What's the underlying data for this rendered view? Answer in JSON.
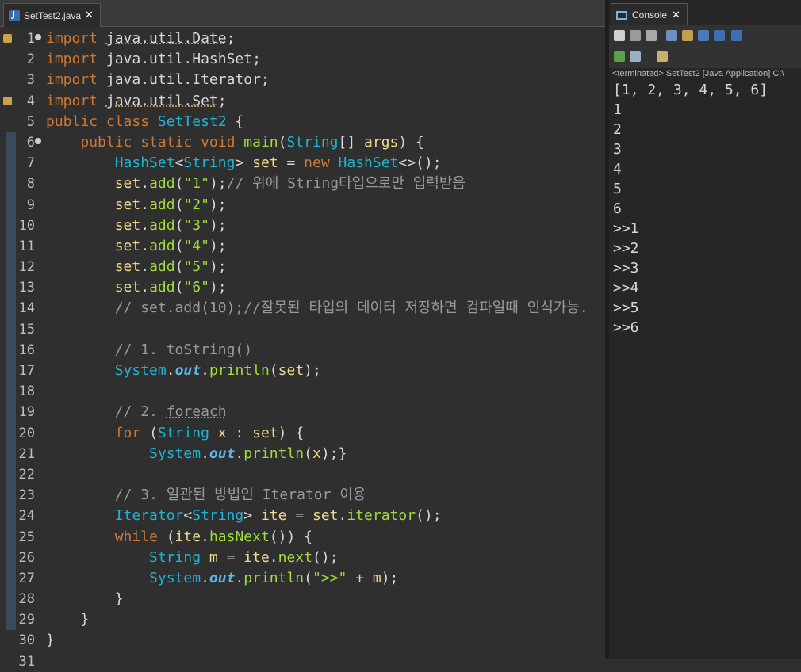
{
  "editor": {
    "tab_label": "SetTest2.java",
    "tab_close": "✕",
    "last_line_number": "31",
    "lines": [
      {
        "n": "1",
        "fold": true,
        "mark": true,
        "segs": [
          [
            "kw",
            "import "
          ],
          [
            "ul",
            "java.util.Date"
          ],
          [
            "",
            ""
          ],
          [
            "",
            ";"
          ]
        ]
      },
      {
        "n": "2",
        "segs": [
          [
            "kw",
            "import "
          ],
          [
            "",
            "java.util.HashSet;"
          ]
        ]
      },
      {
        "n": "3",
        "segs": [
          [
            "kw",
            "import "
          ],
          [
            "",
            "java.util.Iterator;"
          ]
        ]
      },
      {
        "n": "4",
        "mark": true,
        "segs": [
          [
            "kw",
            "import "
          ],
          [
            "ul",
            "java.util.Set"
          ],
          [
            "",
            ";"
          ]
        ]
      },
      {
        "n": "5",
        "segs": [
          [
            "kw",
            "public class "
          ],
          [
            "ty",
            "SetTest2"
          ],
          [
            "",
            " {"
          ]
        ]
      },
      {
        "n": "6",
        "fold": true,
        "ruler": true,
        "segs": [
          [
            "",
            "    "
          ],
          [
            "kw",
            "public static void "
          ],
          [
            "fn",
            "main"
          ],
          [
            "",
            "("
          ],
          [
            "ty",
            "String"
          ],
          [
            "",
            "[] "
          ],
          [
            "var",
            "args"
          ],
          [
            "",
            ") {"
          ]
        ]
      },
      {
        "n": "7",
        "ruler": true,
        "segs": [
          [
            "",
            "        "
          ],
          [
            "ty",
            "HashSet"
          ],
          [
            "",
            "<"
          ],
          [
            "ty",
            "String"
          ],
          [
            "",
            "> "
          ],
          [
            "var",
            "set"
          ],
          [
            "",
            " = "
          ],
          [
            "kw",
            "new "
          ],
          [
            "ty",
            "HashSet"
          ],
          [
            "",
            "<>();"
          ]
        ]
      },
      {
        "n": "8",
        "ruler": true,
        "segs": [
          [
            "",
            "        "
          ],
          [
            "var",
            "set"
          ],
          [
            "",
            "."
          ],
          [
            "fn",
            "add"
          ],
          [
            "",
            "("
          ],
          [
            "str",
            "\"1\""
          ],
          [
            "",
            ");"
          ],
          [
            "cm",
            "// 위에 String타입으로만 입력받음"
          ]
        ]
      },
      {
        "n": "9",
        "ruler": true,
        "segs": [
          [
            "",
            "        "
          ],
          [
            "var",
            "set"
          ],
          [
            "",
            "."
          ],
          [
            "fn",
            "add"
          ],
          [
            "",
            "("
          ],
          [
            "str",
            "\"2\""
          ],
          [
            "",
            ");"
          ]
        ]
      },
      {
        "n": "10",
        "ruler": true,
        "segs": [
          [
            "",
            "        "
          ],
          [
            "var",
            "set"
          ],
          [
            "",
            "."
          ],
          [
            "fn",
            "add"
          ],
          [
            "",
            "("
          ],
          [
            "str",
            "\"3\""
          ],
          [
            "",
            ");"
          ]
        ]
      },
      {
        "n": "11",
        "ruler": true,
        "segs": [
          [
            "",
            "        "
          ],
          [
            "var",
            "set"
          ],
          [
            "",
            "."
          ],
          [
            "fn",
            "add"
          ],
          [
            "",
            "("
          ],
          [
            "str",
            "\"4\""
          ],
          [
            "",
            ");"
          ]
        ]
      },
      {
        "n": "12",
        "ruler": true,
        "segs": [
          [
            "",
            "        "
          ],
          [
            "var",
            "set"
          ],
          [
            "",
            "."
          ],
          [
            "fn",
            "add"
          ],
          [
            "",
            "("
          ],
          [
            "str",
            "\"5\""
          ],
          [
            "",
            ");"
          ]
        ]
      },
      {
        "n": "13",
        "ruler": true,
        "segs": [
          [
            "",
            "        "
          ],
          [
            "var",
            "set"
          ],
          [
            "",
            "."
          ],
          [
            "fn",
            "add"
          ],
          [
            "",
            "("
          ],
          [
            "str",
            "\"6\""
          ],
          [
            "",
            ");"
          ]
        ]
      },
      {
        "n": "14",
        "ruler": true,
        "segs": [
          [
            "",
            "        "
          ],
          [
            "cm",
            "// set.add(10);//잘못된 타입의 데이터 저장하면 컴파일때 인식가능."
          ]
        ]
      },
      {
        "n": "15",
        "ruler": true,
        "segs": []
      },
      {
        "n": "16",
        "ruler": true,
        "segs": [
          [
            "",
            "        "
          ],
          [
            "cm",
            "// 1. toString()"
          ]
        ]
      },
      {
        "n": "17",
        "ruler": true,
        "segs": [
          [
            "",
            "        "
          ],
          [
            "ty",
            "System"
          ],
          [
            "",
            "."
          ],
          [
            "st",
            "out"
          ],
          [
            "",
            "."
          ],
          [
            "fn",
            "println"
          ],
          [
            "",
            "("
          ],
          [
            "var",
            "set"
          ],
          [
            "",
            ");"
          ]
        ]
      },
      {
        "n": "18",
        "ruler": true,
        "segs": []
      },
      {
        "n": "19",
        "ruler": true,
        "segs": [
          [
            "",
            "        "
          ],
          [
            "cm",
            "// 2. "
          ],
          [
            "cmul",
            "foreach"
          ]
        ]
      },
      {
        "n": "20",
        "ruler": true,
        "segs": [
          [
            "",
            "        "
          ],
          [
            "kw",
            "for "
          ],
          [
            "",
            "("
          ],
          [
            "ty",
            "String"
          ],
          [
            "",
            " "
          ],
          [
            "var",
            "x"
          ],
          [
            "",
            " : "
          ],
          [
            "var",
            "set"
          ],
          [
            "",
            ") {"
          ]
        ]
      },
      {
        "n": "21",
        "ruler": true,
        "segs": [
          [
            "",
            "            "
          ],
          [
            "ty",
            "System"
          ],
          [
            "",
            "."
          ],
          [
            "st",
            "out"
          ],
          [
            "",
            "."
          ],
          [
            "fn",
            "println"
          ],
          [
            "",
            "("
          ],
          [
            "var",
            "x"
          ],
          [
            "",
            ");}"
          ]
        ]
      },
      {
        "n": "22",
        "ruler": true,
        "segs": []
      },
      {
        "n": "23",
        "ruler": true,
        "segs": [
          [
            "",
            "        "
          ],
          [
            "cm",
            "// 3. 일관된 방법인 Iterator 이용"
          ]
        ]
      },
      {
        "n": "24",
        "ruler": true,
        "segs": [
          [
            "",
            "        "
          ],
          [
            "ty",
            "Iterator"
          ],
          [
            "",
            "<"
          ],
          [
            "ty",
            "String"
          ],
          [
            "",
            "> "
          ],
          [
            "var",
            "ite"
          ],
          [
            "",
            " = "
          ],
          [
            "var",
            "set"
          ],
          [
            "",
            "."
          ],
          [
            "fn",
            "iterator"
          ],
          [
            "",
            "();"
          ]
        ]
      },
      {
        "n": "25",
        "ruler": true,
        "segs": [
          [
            "",
            "        "
          ],
          [
            "kw",
            "while "
          ],
          [
            "",
            "("
          ],
          [
            "var",
            "ite"
          ],
          [
            "",
            "."
          ],
          [
            "fn",
            "hasNext"
          ],
          [
            "",
            "()) {"
          ]
        ]
      },
      {
        "n": "26",
        "ruler": true,
        "segs": [
          [
            "",
            "            "
          ],
          [
            "ty",
            "String"
          ],
          [
            "",
            " "
          ],
          [
            "var",
            "m"
          ],
          [
            "",
            " = "
          ],
          [
            "var",
            "ite"
          ],
          [
            "",
            "."
          ],
          [
            "fn",
            "next"
          ],
          [
            "",
            "();"
          ]
        ]
      },
      {
        "n": "27",
        "ruler": true,
        "segs": [
          [
            "",
            "            "
          ],
          [
            "ty",
            "System"
          ],
          [
            "",
            "."
          ],
          [
            "st",
            "out"
          ],
          [
            "",
            "."
          ],
          [
            "fn",
            "println"
          ],
          [
            "",
            "("
          ],
          [
            "str",
            "\">>\""
          ],
          [
            "",
            " + "
          ],
          [
            "var",
            "m"
          ],
          [
            "",
            ");"
          ]
        ]
      },
      {
        "n": "28",
        "ruler": true,
        "segs": [
          [
            "",
            "        "
          ],
          [
            "",
            "}"
          ]
        ]
      },
      {
        "n": "29",
        "ruler": true,
        "segs": [
          [
            "",
            "    "
          ],
          [
            "",
            "}"
          ]
        ]
      },
      {
        "n": "30",
        "segs": [
          [
            "",
            "}"
          ]
        ]
      }
    ]
  },
  "console": {
    "tab_label": "Console",
    "tab_close": "✕",
    "status": "<terminated> SetTest2 [Java Application] C:\\",
    "output": [
      "[1, 2, 3, 4, 5, 6]",
      "1",
      "2",
      "3",
      "4",
      "5",
      "6",
      ">>1",
      ">>2",
      ">>3",
      ">>4",
      ">>5",
      ">>6"
    ]
  }
}
